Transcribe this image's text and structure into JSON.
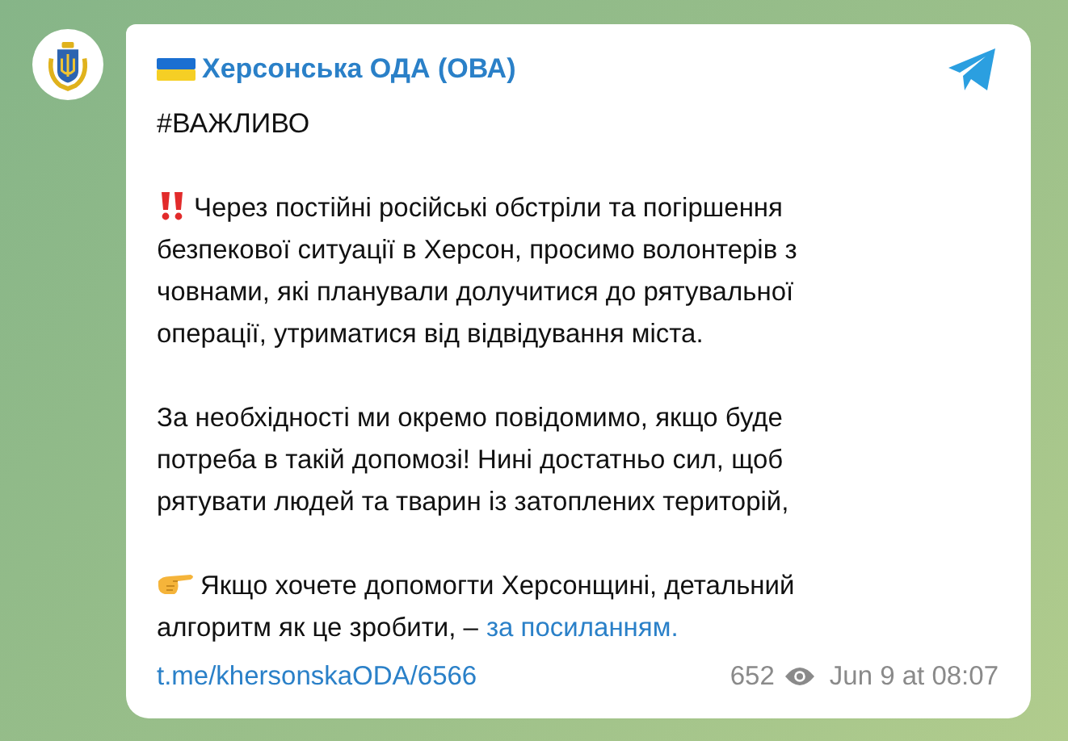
{
  "channel": {
    "name": "Херсонська ОДА (ОВА)"
  },
  "hashtag": "#ВАЖЛИВО",
  "paragraphs": [
    {
      "kind": "alert",
      "lines": [
        "Через постійні російські обстріли та погіршення",
        "безпекової ситуації в Херсон, просимо волонтерів з",
        "човнами, які планували долучитися до рятувальної",
        "операції, утриматися від відвідування міста."
      ]
    },
    {
      "kind": "plain",
      "lines": [
        "За необхідності ми окремо повідомимо, якщо буде",
        "потреба в такій допомозі! Нині достатньо сил, щоб",
        "рятувати людей та тварин із затоплених територій,"
      ]
    },
    {
      "kind": "pointer",
      "lines": [
        "Якщо хочете допомогти Херсонщині, детальний",
        "алгоритм як це зробити, –"
      ],
      "link": "за посиланням."
    }
  ],
  "footer": {
    "post_link": "t.me/khersonskaODA/6566",
    "views": "652",
    "date": "Jun 9 at 08:07"
  }
}
